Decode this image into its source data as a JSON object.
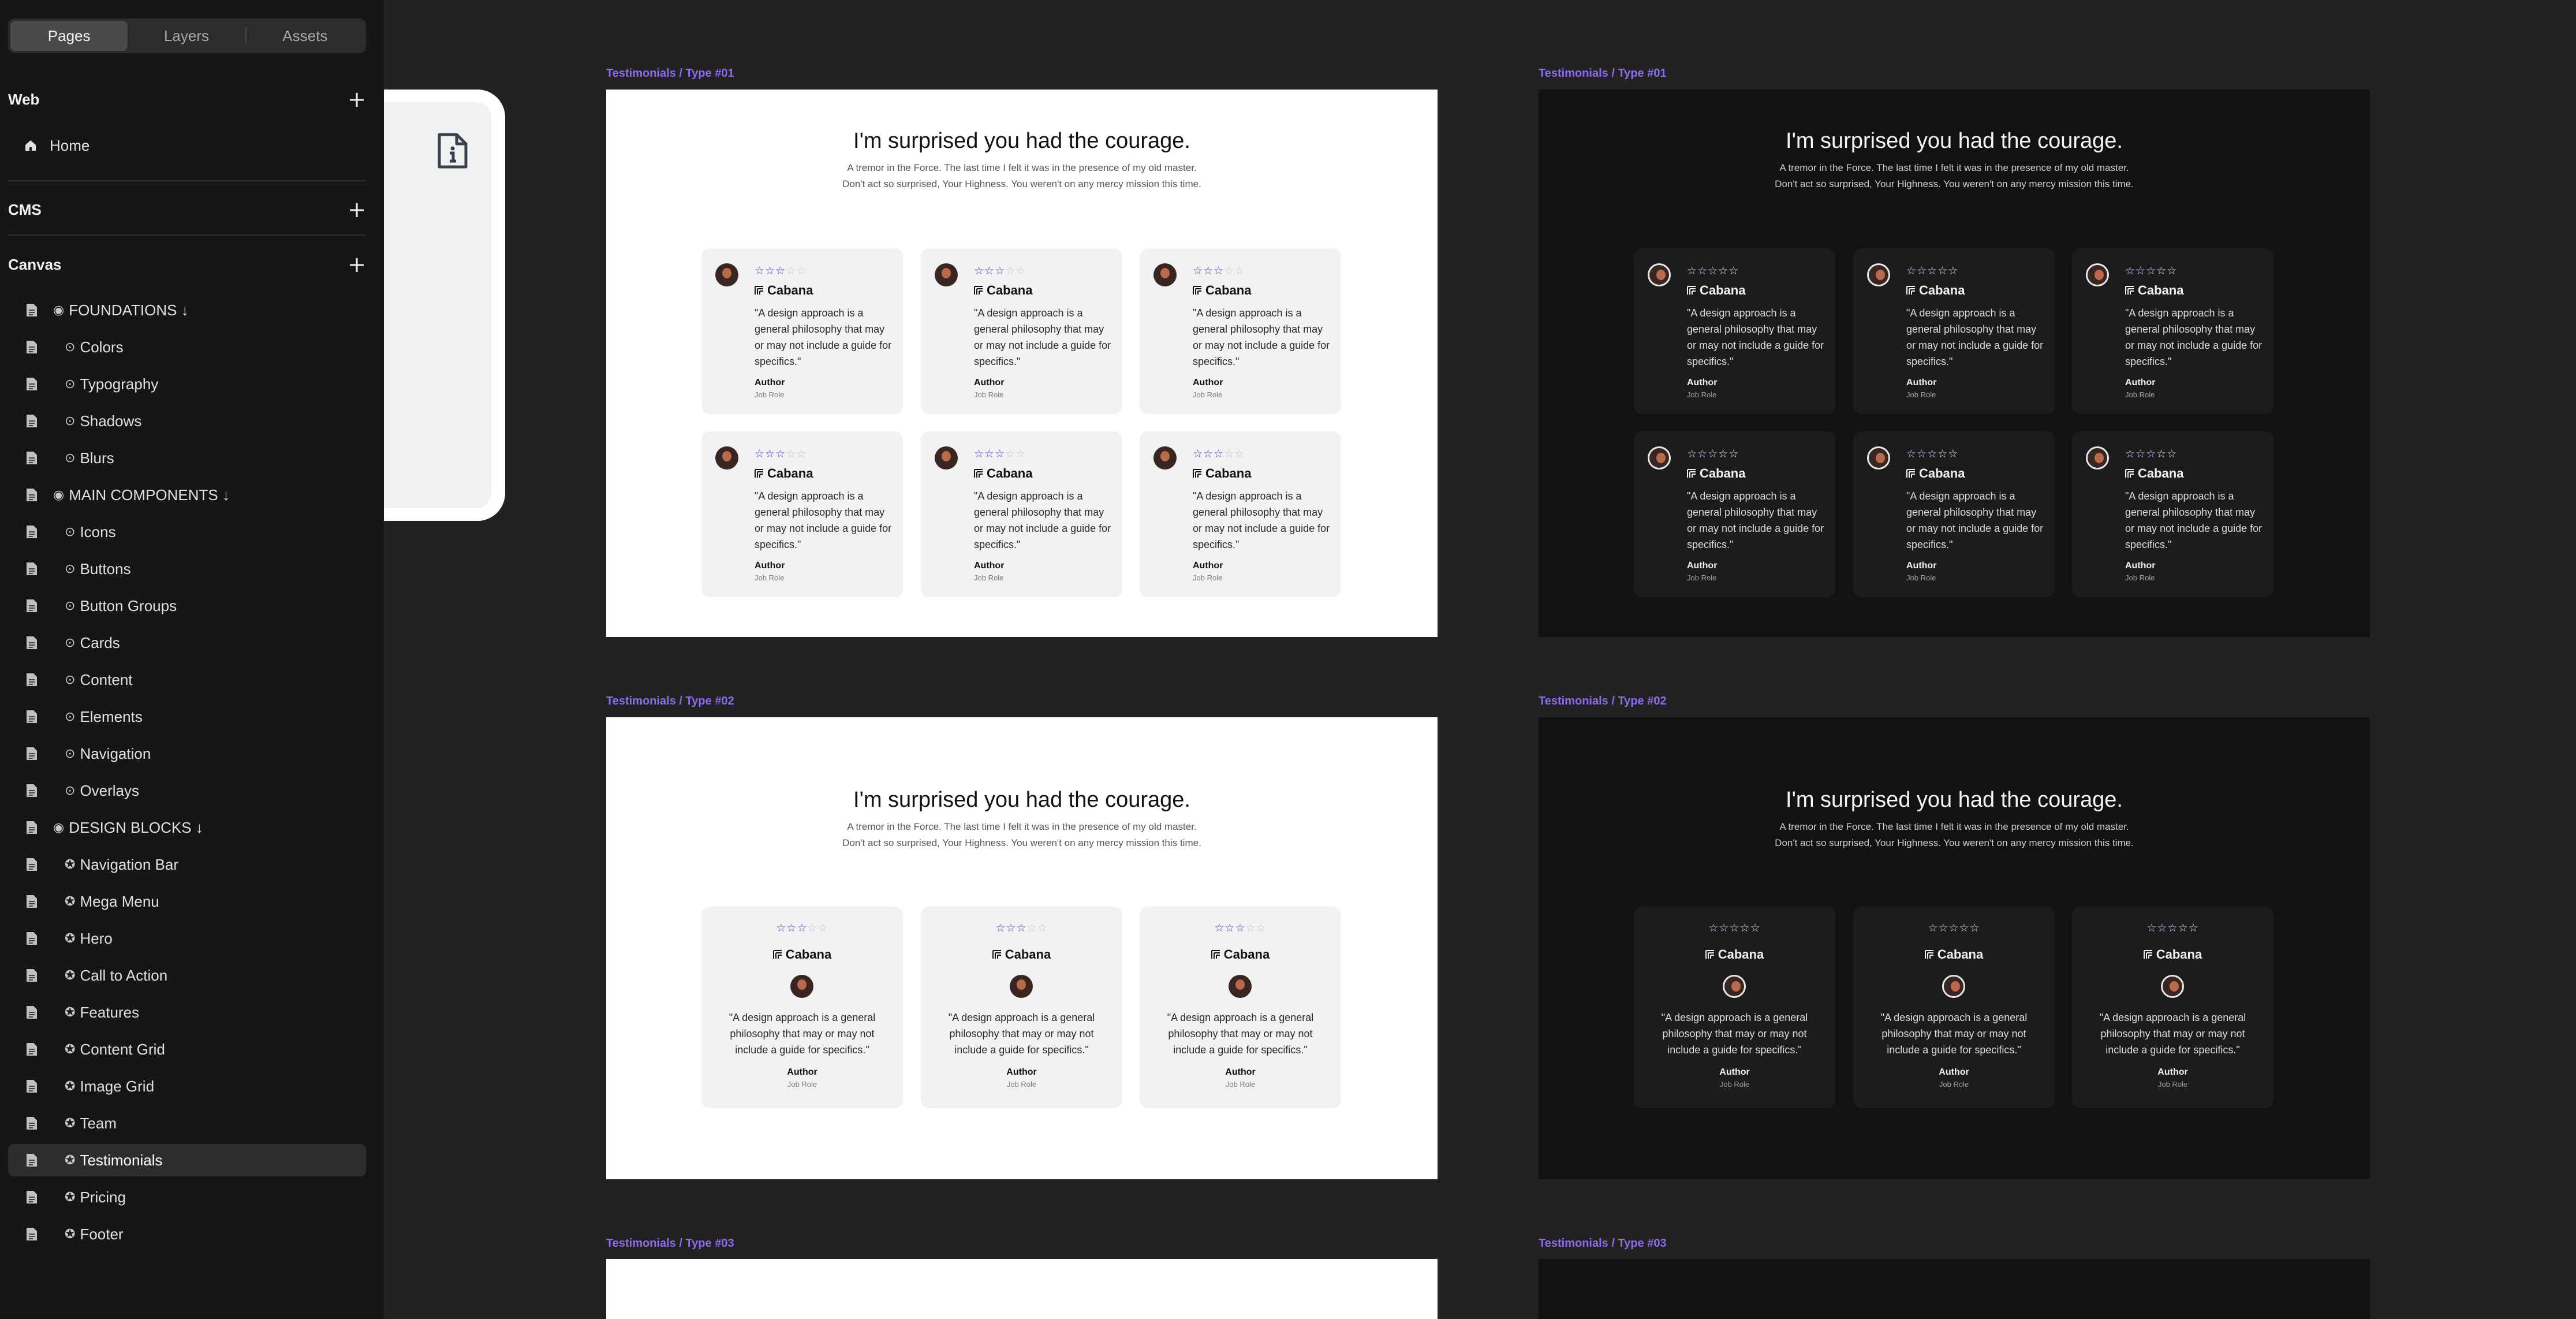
{
  "sidebar": {
    "tabs": [
      "Pages",
      "Layers",
      "Assets"
    ],
    "web": {
      "title": "Web",
      "items": [
        "Home"
      ]
    },
    "cms": {
      "title": "CMS"
    },
    "canvas": {
      "title": "Canvas",
      "items": [
        {
          "label": "FOUNDATIONS ↓",
          "marker": "◉",
          "level": 0
        },
        {
          "label": "Colors",
          "marker": "⊙",
          "level": 1
        },
        {
          "label": "Typography",
          "marker": "⊙",
          "level": 1
        },
        {
          "label": "Shadows",
          "marker": "⊙",
          "level": 1
        },
        {
          "label": "Blurs",
          "marker": "⊙",
          "level": 1
        },
        {
          "label": "MAIN COMPONENTS ↓",
          "marker": "◉",
          "level": 0
        },
        {
          "label": "Icons",
          "marker": "⊙",
          "level": 1
        },
        {
          "label": "Buttons",
          "marker": "⊙",
          "level": 1
        },
        {
          "label": "Button Groups",
          "marker": "⊙",
          "level": 1
        },
        {
          "label": "Cards",
          "marker": "⊙",
          "level": 1
        },
        {
          "label": "Content",
          "marker": "⊙",
          "level": 1
        },
        {
          "label": "Elements",
          "marker": "⊙",
          "level": 1
        },
        {
          "label": "Navigation",
          "marker": "⊙",
          "level": 1
        },
        {
          "label": "Overlays",
          "marker": "⊙",
          "level": 1
        },
        {
          "label": "DESIGN BLOCKS ↓",
          "marker": "◉",
          "level": 0
        },
        {
          "label": "Navigation Bar",
          "marker": "✪",
          "level": 1
        },
        {
          "label": "Mega Menu",
          "marker": "✪",
          "level": 1
        },
        {
          "label": "Hero",
          "marker": "✪",
          "level": 1
        },
        {
          "label": "Call to Action",
          "marker": "✪",
          "level": 1
        },
        {
          "label": "Features",
          "marker": "✪",
          "level": 1
        },
        {
          "label": "Content Grid",
          "marker": "✪",
          "level": 1
        },
        {
          "label": "Image Grid",
          "marker": "✪",
          "level": 1
        },
        {
          "label": "Team",
          "marker": "✪",
          "level": 1
        },
        {
          "label": "Testimonials",
          "marker": "✪",
          "level": 1
        },
        {
          "label": "Pricing",
          "marker": "✪",
          "level": 1
        },
        {
          "label": "Footer",
          "marker": "✪",
          "level": 1
        }
      ],
      "selected": "Testimonials"
    }
  },
  "canvas": {
    "frame_labels": {
      "type1": "Testimonials / Type #01",
      "type2": "Testimonials / Type #02",
      "type3": "Testimonials / Type #03"
    },
    "section": {
      "heading": "I'm surprised you had the courage.",
      "line1": "A tremor in the Force. The last time I felt it was in the presence of my old master.",
      "line2": "Don't act so surprised, Your Highness. You weren't on any mercy mission this time."
    },
    "card": {
      "brand": "Cabana",
      "quote_t1": "\"A design approach is a general philosophy that may or may not include a guide for specifics.\"",
      "quote_t2": "\"A design approach is a general philosophy that may or may not include a guide for specifics.\"",
      "author": "Author",
      "role": "Job Role",
      "rating": 3,
      "max_rating": 5
    },
    "colors": {
      "accent": "#8b6cf0",
      "star": "#4b4fb8",
      "sidebar_bg": "#161616",
      "canvas_bg": "#222222"
    }
  }
}
